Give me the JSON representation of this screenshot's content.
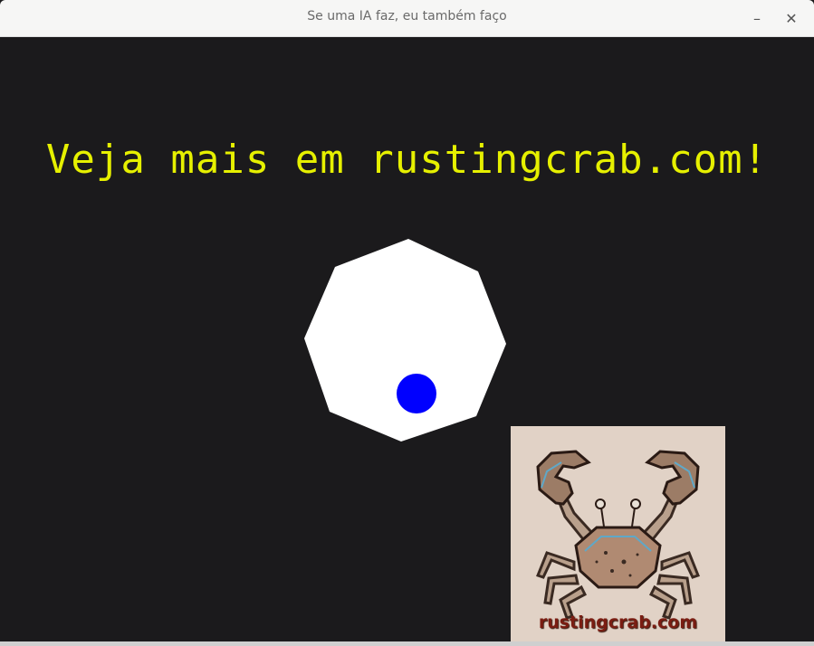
{
  "window": {
    "title": "Se uma IA faz, eu também faço",
    "minimize_glyph": "–",
    "close_glyph": "✕"
  },
  "canvas": {
    "background": "#1b1a1c",
    "headline": "Veja mais em rustingcrab.com!",
    "headline_color": "#e6f000",
    "octagon_color": "#ffffff",
    "ball_color": "#0000ff"
  },
  "logo": {
    "text": "rustingcrab.com",
    "icon": "crab-icon",
    "background": "#e1d2c6"
  }
}
